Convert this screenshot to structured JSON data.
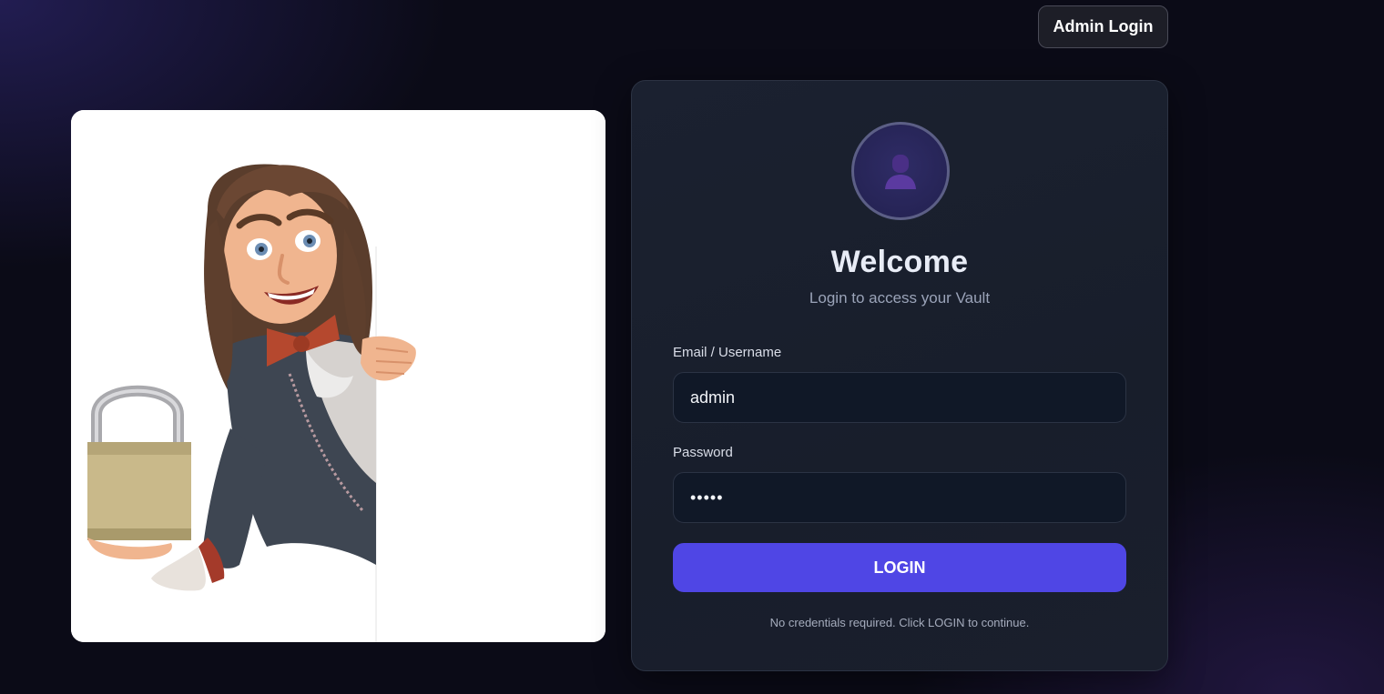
{
  "header": {
    "admin_login_label": "Admin Login"
  },
  "illustration": {
    "icon": "mascot-with-padlock-illustration"
  },
  "login_card": {
    "avatar_icon": "user-silhouette-icon",
    "title": "Welcome",
    "subtitle": "Login to access your Vault",
    "email_label": "Email / Username",
    "email_value": "admin",
    "password_label": "Password",
    "password_value": "•••••",
    "login_button_label": "LOGIN",
    "hint": "No credentials required. Click LOGIN to continue."
  },
  "colors": {
    "background": "#0b0b17",
    "card": "#1b2130",
    "accent": "#4f46e5",
    "field_bg": "#101827"
  }
}
